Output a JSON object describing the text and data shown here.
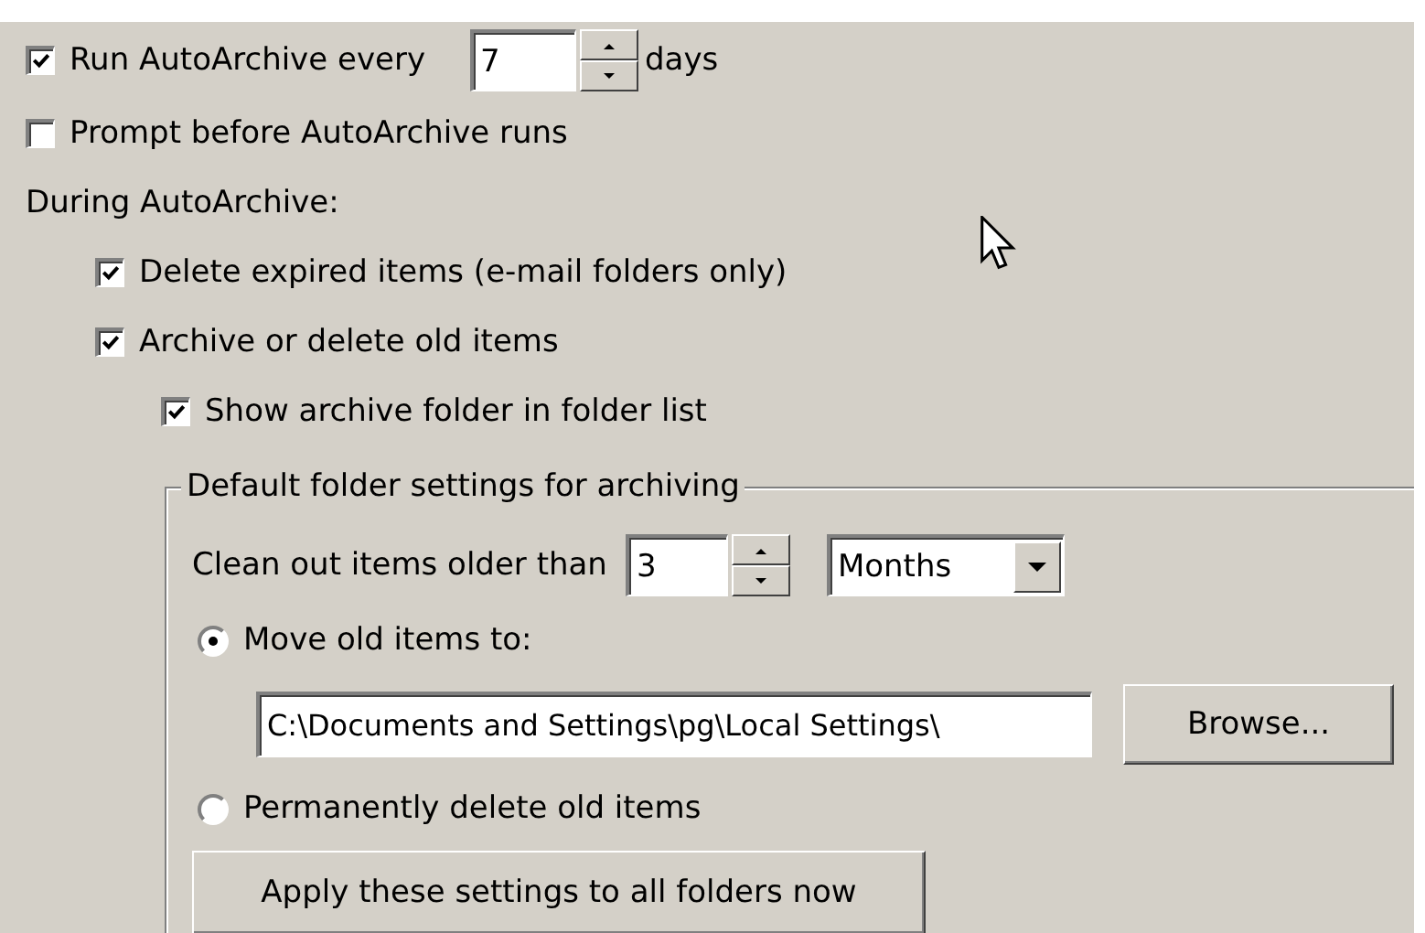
{
  "run_autoarchive": {
    "checked": true,
    "label": "Run AutoArchive every",
    "value": "7",
    "unit": "days"
  },
  "prompt": {
    "checked": false,
    "label": "Prompt before AutoArchive runs"
  },
  "during_label": "During AutoArchive:",
  "during_options": [
    {
      "label": "Delete expired items (e-mail folders only)",
      "checked": true
    },
    {
      "label": "Archive or delete old items",
      "checked": true,
      "children": [
        {
          "label": "Show archive folder in folder list",
          "checked": true
        }
      ]
    }
  ],
  "group": {
    "title": "Default folder settings for archiving",
    "clean_label": "Clean out items older than",
    "clean_value": "3",
    "clean_unit": "Months",
    "actions": [
      {
        "label": "Move old items to:",
        "selected": true,
        "path": "C:\\Documents and Settings\\pg\\Local Settings\\",
        "browse": "Browse..."
      },
      {
        "label": "Permanently delete old items",
        "selected": false
      }
    ],
    "apply_button": "Apply these settings to all folders now"
  }
}
